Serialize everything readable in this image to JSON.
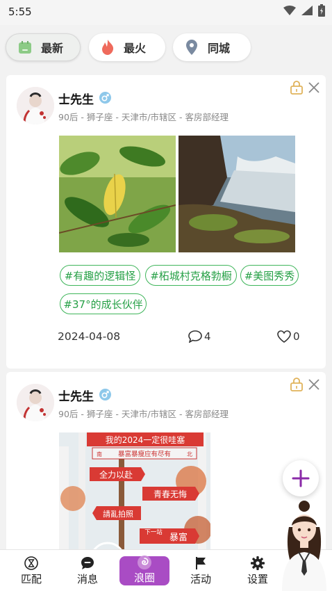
{
  "status_bar": {
    "time": "5:55"
  },
  "filters": [
    {
      "label": "最新",
      "icon": "calendar-icon",
      "active": true
    },
    {
      "label": "最火",
      "icon": "flame-icon",
      "active": false
    },
    {
      "label": "同城",
      "icon": "location-pin-icon",
      "active": false
    }
  ],
  "posts": [
    {
      "user": {
        "name": "士先生",
        "gender": "male",
        "meta": "90后 - 狮子座 - 天津市/市辖区 - 客房部经理"
      },
      "photos": [
        "leaves-photo",
        "waterfall-photo"
      ],
      "tags": [
        "#有趣的逻辑怪",
        "#柘城村克格勃橱",
        "#美图秀秀",
        "#37°的成长伙伴"
      ],
      "date": "2024-04-08",
      "comments": "4",
      "likes": "0"
    },
    {
      "user": {
        "name": "士先生",
        "gender": "male",
        "meta": "90后 - 狮子座 - 天津市/市辖区 - 客房部经理"
      },
      "photos": [
        "signpost-photo"
      ],
      "sign_texts": {
        "banner": "我的2024一定很哇塞",
        "subbanner": "暴富暴瘦应有尽有",
        "sub_left": "南",
        "sub_right": "北",
        "arrow1": "全力以赴",
        "arrow2": "青春无悔",
        "arrow3": "請亂拍照",
        "arrow4_small": "下一站",
        "arrow4_big": "暴富"
      }
    }
  ],
  "bottom_nav": [
    {
      "label": "匹配",
      "icon": "hourglass-icon"
    },
    {
      "label": "消息",
      "icon": "chat-icon"
    },
    {
      "label": "浪圈",
      "icon": "swirl-icon",
      "active": true
    },
    {
      "label": "活动",
      "icon": "flag-icon"
    },
    {
      "label": "设置",
      "icon": "gear-icon"
    }
  ],
  "colors": {
    "tag_green": "#26a046",
    "nav_accent": "#a94cc4",
    "fab_plus": "#8a2aa8"
  }
}
